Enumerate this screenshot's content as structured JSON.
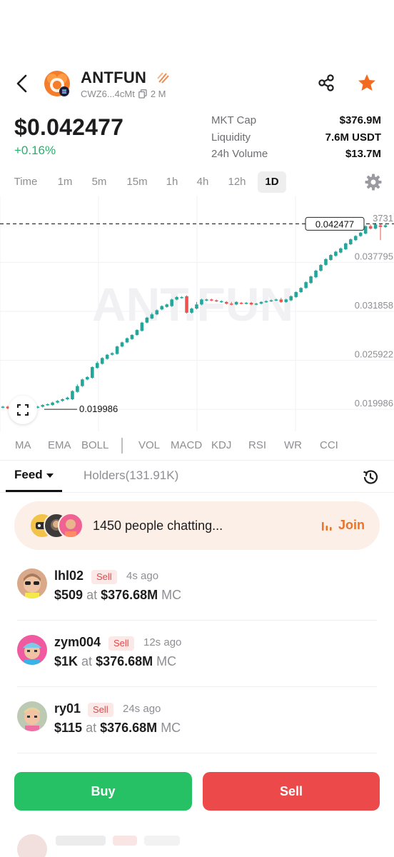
{
  "header": {
    "token_name": "ANTFUN",
    "address": "CWZ6...4cMt",
    "holders_short": "2 M"
  },
  "price": {
    "value": "$0.042477",
    "change": "+0.16%"
  },
  "stats": [
    {
      "label": "MKT Cap",
      "value": "$376.9M"
    },
    {
      "label": "Liquidity",
      "value": "7.6M USDT"
    },
    {
      "label": "24h Volume",
      "value": "$13.7M"
    }
  ],
  "time_tabs": [
    "Time",
    "1m",
    "5m",
    "15m",
    "1h",
    "4h",
    "12h",
    "1D"
  ],
  "active_tab": "1D",
  "chart_data": {
    "type": "candlestick",
    "watermark": "ANT.FUN",
    "current_price_label": "0.042477",
    "top_cut_label": "3731",
    "min_label": "0.019986",
    "y_ticks": [
      "0.037795",
      "0.031858",
      "0.025922",
      "0.019986"
    ],
    "ylim": [
      0.018,
      0.0452
    ],
    "colors": {
      "up": "#26a69a",
      "down": "#ef5350"
    },
    "candles": [
      [
        0.0202,
        0.0203,
        0.0201,
        0.0204
      ],
      [
        0.0203,
        0.0201,
        0.02,
        0.0204
      ],
      [
        0.0201,
        0.02,
        0.0199,
        0.0202
      ],
      [
        0.02,
        0.0201,
        0.0199,
        0.0202
      ],
      [
        0.0201,
        0.02,
        0.0199,
        0.0202
      ],
      [
        0.02,
        0.0201,
        0.0199,
        0.0202
      ],
      [
        0.02,
        0.0202,
        0.0199,
        0.0203
      ],
      [
        0.0202,
        0.0203,
        0.0201,
        0.0204
      ],
      [
        0.0203,
        0.0205,
        0.0202,
        0.0206
      ],
      [
        0.0205,
        0.0206,
        0.0204,
        0.0207
      ],
      [
        0.0205,
        0.0208,
        0.0204,
        0.0209
      ],
      [
        0.0208,
        0.021,
        0.0207,
        0.0211
      ],
      [
        0.021,
        0.0212,
        0.0209,
        0.0213
      ],
      [
        0.0212,
        0.0214,
        0.0211,
        0.0215
      ],
      [
        0.0212,
        0.0222,
        0.0211,
        0.0223
      ],
      [
        0.0221,
        0.0228,
        0.022,
        0.023
      ],
      [
        0.0228,
        0.0236,
        0.0227,
        0.0237
      ],
      [
        0.0236,
        0.0239,
        0.0235,
        0.024
      ],
      [
        0.0238,
        0.0251,
        0.0237,
        0.0252
      ],
      [
        0.025,
        0.0256,
        0.0249,
        0.0258
      ],
      [
        0.0255,
        0.0262,
        0.0254,
        0.0263
      ],
      [
        0.0261,
        0.0266,
        0.026,
        0.0267
      ],
      [
        0.0266,
        0.0268,
        0.0265,
        0.0269
      ],
      [
        0.0267,
        0.0276,
        0.0266,
        0.0277
      ],
      [
        0.0276,
        0.0281,
        0.0275,
        0.0282
      ],
      [
        0.0281,
        0.0286,
        0.028,
        0.0287
      ],
      [
        0.0285,
        0.029,
        0.0284,
        0.0291
      ],
      [
        0.029,
        0.0296,
        0.0289,
        0.0297
      ],
      [
        0.0295,
        0.0305,
        0.0294,
        0.0306
      ],
      [
        0.0305,
        0.0311,
        0.0304,
        0.0312
      ],
      [
        0.031,
        0.0315,
        0.0309,
        0.0317
      ],
      [
        0.0315,
        0.032,
        0.0314,
        0.0321
      ],
      [
        0.0321,
        0.0325,
        0.032,
        0.0326
      ],
      [
        0.0324,
        0.0327,
        0.0323,
        0.0328
      ],
      [
        0.0325,
        0.0333,
        0.0324,
        0.0334
      ],
      [
        0.0333,
        0.0336,
        0.0332,
        0.0337
      ],
      [
        0.0335,
        0.0336,
        0.0334,
        0.0337
      ],
      [
        0.0337,
        0.0317,
        0.0316,
        0.0338
      ],
      [
        0.0317,
        0.0322,
        0.0316,
        0.0323
      ],
      [
        0.0322,
        0.0327,
        0.0321,
        0.033
      ],
      [
        0.0327,
        0.0333,
        0.0326,
        0.0334
      ],
      [
        0.0332,
        0.0333,
        0.0331,
        0.0334
      ],
      [
        0.0333,
        0.0332,
        0.0331,
        0.0334
      ],
      [
        0.0332,
        0.0331,
        0.033,
        0.0333
      ],
      [
        0.033,
        0.0331,
        0.0329,
        0.0332
      ],
      [
        0.033,
        0.0328,
        0.0327,
        0.0331
      ],
      [
        0.0328,
        0.0327,
        0.0326,
        0.033
      ],
      [
        0.0327,
        0.033,
        0.0326,
        0.0331
      ],
      [
        0.0329,
        0.0328,
        0.0327,
        0.033
      ],
      [
        0.0328,
        0.0329,
        0.0327,
        0.033
      ],
      [
        0.0329,
        0.0327,
        0.0326,
        0.033
      ],
      [
        0.0327,
        0.0328,
        0.0326,
        0.0329
      ],
      [
        0.0328,
        0.033,
        0.0327,
        0.0331
      ],
      [
        0.033,
        0.0331,
        0.0329,
        0.0332
      ],
      [
        0.0331,
        0.0332,
        0.033,
        0.0333
      ],
      [
        0.0332,
        0.0333,
        0.0331,
        0.0334
      ],
      [
        0.0333,
        0.033,
        0.0329,
        0.0335
      ],
      [
        0.033,
        0.0333,
        0.0329,
        0.0334
      ],
      [
        0.0332,
        0.0337,
        0.0331,
        0.0338
      ],
      [
        0.0336,
        0.0342,
        0.0335,
        0.0343
      ],
      [
        0.0342,
        0.0347,
        0.0341,
        0.0348
      ],
      [
        0.0347,
        0.0354,
        0.0346,
        0.0355
      ],
      [
        0.0353,
        0.0361,
        0.0352,
        0.0362
      ],
      [
        0.036,
        0.0368,
        0.0359,
        0.0369
      ],
      [
        0.0368,
        0.0375,
        0.0367,
        0.0376
      ],
      [
        0.0375,
        0.0382,
        0.0374,
        0.0383
      ],
      [
        0.0381,
        0.0387,
        0.038,
        0.0388
      ],
      [
        0.0386,
        0.0391,
        0.0385,
        0.0392
      ],
      [
        0.039,
        0.0395,
        0.0389,
        0.0396
      ],
      [
        0.0394,
        0.0401,
        0.0393,
        0.0402
      ],
      [
        0.04,
        0.0406,
        0.0399,
        0.0407
      ],
      [
        0.0405,
        0.041,
        0.0404,
        0.0411
      ],
      [
        0.041,
        0.0414,
        0.0409,
        0.0415
      ],
      [
        0.0413,
        0.0422,
        0.0412,
        0.0423
      ],
      [
        0.0422,
        0.0419,
        0.0418,
        0.0424
      ],
      [
        0.0419,
        0.0424,
        0.0418,
        0.0426
      ],
      [
        0.0423,
        0.0421,
        0.0405,
        0.0425
      ],
      [
        0.0421,
        0.0423,
        0.042,
        0.0425
      ]
    ]
  },
  "indicators": [
    "MA",
    "EMA",
    "BOLL",
    "VOL",
    "MACD",
    "KDJ",
    "RSI",
    "WR",
    "CCI"
  ],
  "feed": {
    "tab_feed": "Feed",
    "tab_holders": "Holders(131.91K)"
  },
  "chat": {
    "text": "1450 people chatting...",
    "join": "Join"
  },
  "feed_items": [
    {
      "user": "lhl02",
      "badge": "Sell",
      "time": "4s ago",
      "amount": "$509",
      "at": "at",
      "mc": "$376.68M",
      "mc_label": "MC",
      "avatar_color": "#d9a98a"
    },
    {
      "user": "zym004",
      "badge": "Sell",
      "time": "12s ago",
      "amount": "$1K",
      "at": "at",
      "mc": "$376.68M",
      "mc_label": "MC",
      "avatar_color": "#f05aa0"
    },
    {
      "user": "ry01",
      "badge": "Sell",
      "time": "24s ago",
      "amount": "$115",
      "at": "at",
      "mc": "$376.68M",
      "mc_label": "MC",
      "avatar_color": "#bcc9b3"
    }
  ],
  "actions": {
    "buy": "Buy",
    "sell": "Sell"
  },
  "colors": {
    "up": "#23b26d",
    "buy": "#26c065",
    "sell": "#ec4a4a",
    "accent": "#e8752b",
    "star": "#f26b21"
  }
}
